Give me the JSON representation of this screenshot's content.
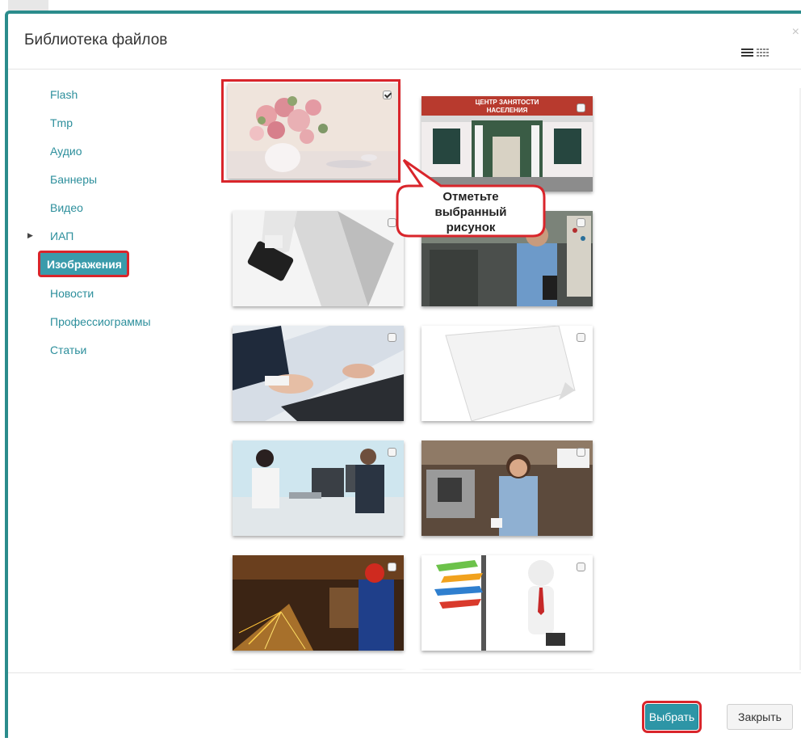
{
  "dialog": {
    "title": "Библиотека файлов",
    "close_glyph": "×"
  },
  "folders": [
    {
      "label": "Flash"
    },
    {
      "label": "Tmp"
    },
    {
      "label": "Аудио"
    },
    {
      "label": "Баннеры"
    },
    {
      "label": "Видео"
    },
    {
      "label": "ИАП",
      "collapsible": true
    },
    {
      "label": "Изображения",
      "selected": true
    },
    {
      "label": "Новости"
    },
    {
      "label": "Профессиограммы"
    },
    {
      "label": "Статьи"
    }
  ],
  "images": [
    {
      "name": "roses-in-vase",
      "checked": true
    },
    {
      "name": "employment-center-building",
      "checked": false
    },
    {
      "name": "briefcase-businessman",
      "checked": false
    },
    {
      "name": "factory-worker-panel",
      "checked": false
    },
    {
      "name": "hands-on-keyboard",
      "checked": false
    },
    {
      "name": "paper-sheet",
      "checked": false
    },
    {
      "name": "office-computer-workers",
      "checked": false
    },
    {
      "name": "barista-woman",
      "checked": false
    },
    {
      "name": "welder-sparks",
      "checked": false
    },
    {
      "name": "figure-with-signpost",
      "checked": false
    }
  ],
  "callout": {
    "line1": "Отметьте",
    "line2": "выбранный",
    "line3": "рисунок"
  },
  "buttons": {
    "select": "Выбрать",
    "close": "Закрыть"
  },
  "colors": {
    "accent": "#2d95a6",
    "highlight": "#d9252b",
    "link": "#2d8f9c"
  },
  "icons": {
    "list_view": "list-view-icon",
    "grid_view": "grid-view-icon",
    "collapse_arrow": "caret-right-icon"
  }
}
